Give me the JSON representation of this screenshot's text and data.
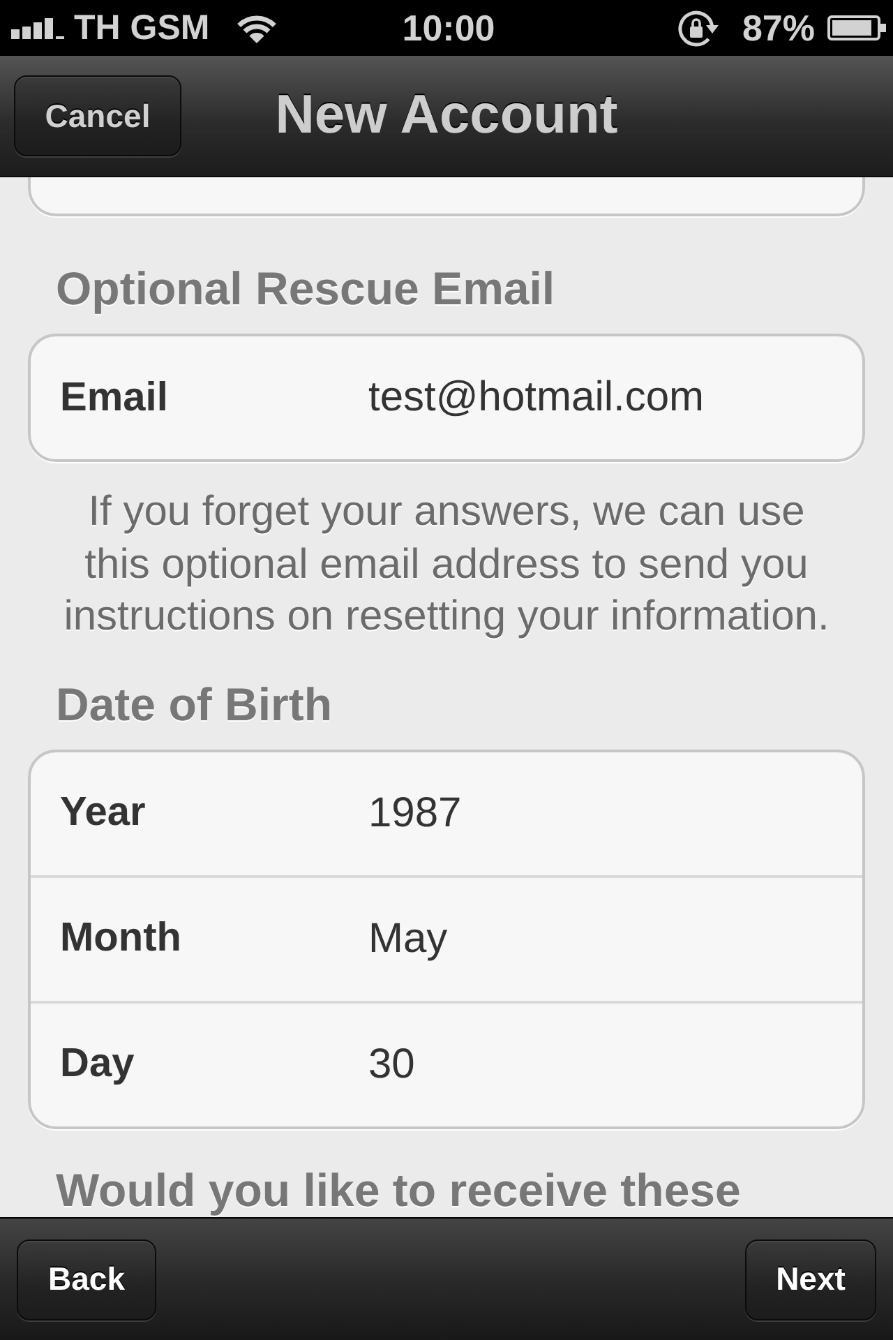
{
  "status_bar": {
    "carrier": "TH GSM",
    "time": "10:00",
    "battery": "87%"
  },
  "nav_bar": {
    "left_button": "Cancel",
    "title": "New Account"
  },
  "sections": [
    {
      "heading": "Optional Rescue Email",
      "rows": [
        {
          "label": "Email",
          "value": "test@hotmail.com"
        }
      ],
      "footer": "If you forget your answers, we can use this optional email address to send you instructions on resetting your information."
    },
    {
      "heading": "Date of Birth",
      "rows": [
        {
          "label": "Year",
          "value": "1987"
        },
        {
          "label": "Month",
          "value": "May"
        },
        {
          "label": "Day",
          "value": "30"
        }
      ]
    },
    {
      "heading": "Would you like to receive these"
    }
  ],
  "toolbar": {
    "left_button": "Back",
    "right_button": "Next"
  }
}
